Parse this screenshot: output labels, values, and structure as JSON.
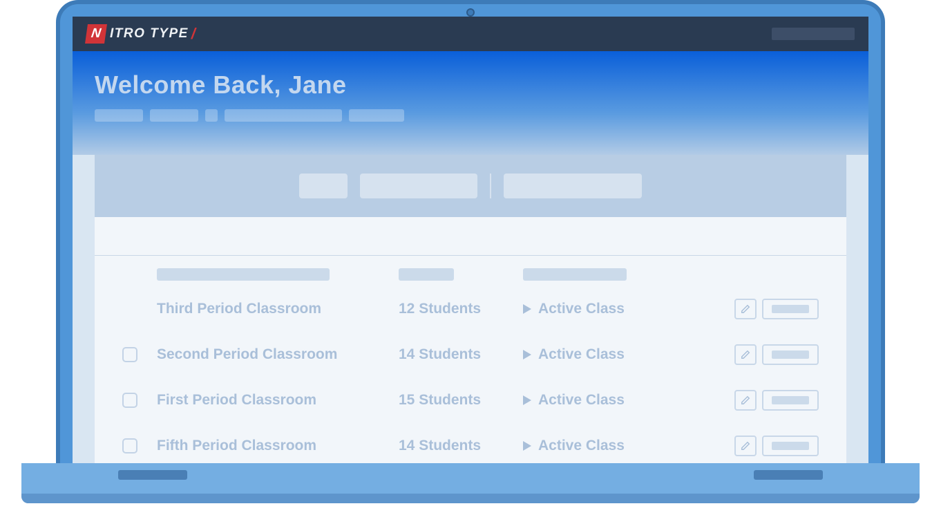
{
  "logo": {
    "letter": "N",
    "text": "ITRO TYPE",
    "slash": "/"
  },
  "hero": {
    "title": "Welcome Back, Jane"
  },
  "rows": [
    {
      "name": "Third Period Classroom",
      "students": "12 Students",
      "status": "Active Class",
      "checkbox": false
    },
    {
      "name": "Second Period Classroom",
      "students": "14 Students",
      "status": "Active Class",
      "checkbox": true
    },
    {
      "name": "First Period Classroom",
      "students": "15 Students",
      "status": "Active Class",
      "checkbox": true
    },
    {
      "name": "Fifth Period Classroom",
      "students": "14 Students",
      "status": "Active Class",
      "checkbox": true
    }
  ]
}
